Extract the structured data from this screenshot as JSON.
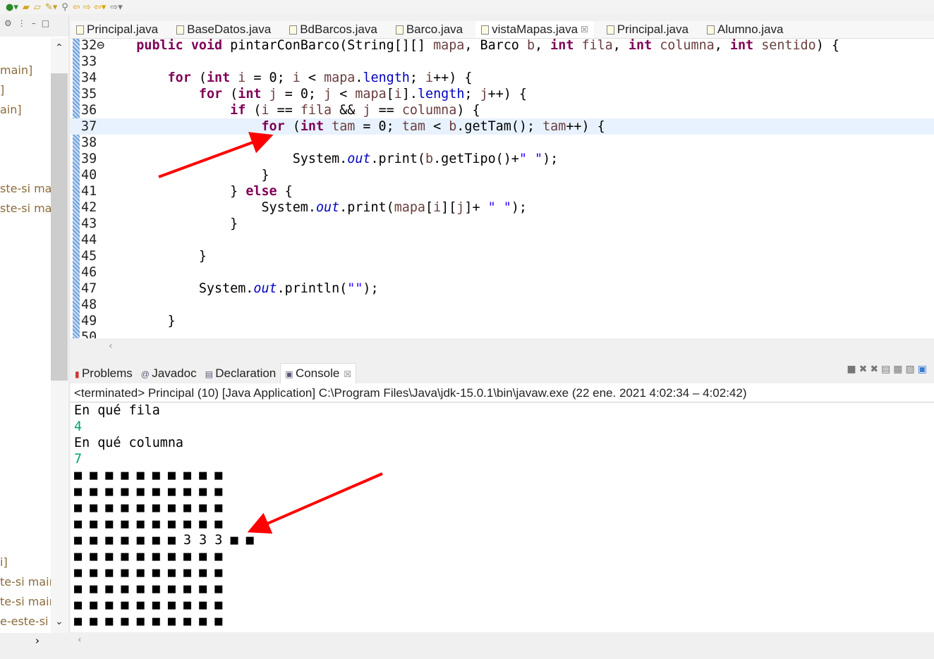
{
  "toolbar": {
    "icons": [
      "run-icon",
      "open-icon",
      "folder-icon",
      "pencil-icon",
      "pin-icon",
      "back-icon",
      "forward-icon"
    ]
  },
  "left_panel": {
    "items": [
      "main]",
      "]",
      "ain]",
      "ste-si ma",
      "ste-si ma",
      "i]",
      "te-si mair",
      "te-si mair",
      "e-este-si i"
    ]
  },
  "tabs": [
    "Principal.java",
    "BaseDatos.java",
    "BdBarcos.java",
    "Barco.java",
    "vistaMapas.java",
    "Principal.java",
    "Alumno.java"
  ],
  "active_tab": 4,
  "tab_close": "☒",
  "editor": {
    "current_line": 5,
    "lines": [
      {
        "n": "32⊖",
        "t": [
          [
            "    ",
            ""
          ],
          [
            "public",
            "k"
          ],
          [
            " ",
            ""
          ],
          [
            "void",
            "k"
          ],
          [
            " pintarConBarco(String[][] ",
            ""
          ],
          [
            "mapa",
            "v"
          ],
          [
            ", Barco ",
            ""
          ],
          [
            "b",
            "v"
          ],
          [
            ", ",
            ""
          ],
          [
            "int",
            "k"
          ],
          [
            " ",
            ""
          ],
          [
            "fila",
            "v"
          ],
          [
            ", ",
            ""
          ],
          [
            "int",
            "k"
          ],
          [
            " ",
            ""
          ],
          [
            "columna",
            "v"
          ],
          [
            ", ",
            ""
          ],
          [
            "int",
            "k"
          ],
          [
            " ",
            ""
          ],
          [
            "sentido",
            "v"
          ],
          [
            ") {",
            ""
          ]
        ]
      },
      {
        "n": "33",
        "t": []
      },
      {
        "n": "34",
        "t": [
          [
            "        ",
            ""
          ],
          [
            "for",
            "k"
          ],
          [
            " (",
            ""
          ],
          [
            "int",
            "k"
          ],
          [
            " ",
            ""
          ],
          [
            "i",
            "v"
          ],
          [
            " = 0; ",
            ""
          ],
          [
            "i",
            "v"
          ],
          [
            " < ",
            ""
          ],
          [
            "mapa",
            "v"
          ],
          [
            ".",
            ""
          ],
          [
            "length",
            "f"
          ],
          [
            "; ",
            ""
          ],
          [
            "i",
            "v"
          ],
          [
            "++) {",
            ""
          ]
        ]
      },
      {
        "n": "35",
        "t": [
          [
            "            ",
            ""
          ],
          [
            "for",
            "k"
          ],
          [
            " (",
            ""
          ],
          [
            "int",
            "k"
          ],
          [
            " ",
            ""
          ],
          [
            "j",
            "v"
          ],
          [
            " = 0; ",
            ""
          ],
          [
            "j",
            "v"
          ],
          [
            " < ",
            ""
          ],
          [
            "mapa",
            "v"
          ],
          [
            "[",
            ""
          ],
          [
            "i",
            "v"
          ],
          [
            "].",
            ""
          ],
          [
            "length",
            "f"
          ],
          [
            "; ",
            ""
          ],
          [
            "j",
            "v"
          ],
          [
            "++) {",
            ""
          ]
        ]
      },
      {
        "n": "36",
        "t": [
          [
            "                ",
            ""
          ],
          [
            "if",
            "k"
          ],
          [
            " (",
            ""
          ],
          [
            "i",
            "v"
          ],
          [
            " == ",
            ""
          ],
          [
            "fila",
            "v"
          ],
          [
            " && ",
            ""
          ],
          [
            "j",
            "v"
          ],
          [
            " == ",
            ""
          ],
          [
            "columna",
            "v"
          ],
          [
            ") {",
            ""
          ]
        ]
      },
      {
        "n": "37",
        "t": [
          [
            "                    ",
            ""
          ],
          [
            "for",
            "k"
          ],
          [
            " (",
            ""
          ],
          [
            "int",
            "k"
          ],
          [
            " ",
            ""
          ],
          [
            "tam",
            "v"
          ],
          [
            " = 0; ",
            ""
          ],
          [
            "tam",
            "v"
          ],
          [
            " < ",
            ""
          ],
          [
            "b",
            "v"
          ],
          [
            ".getTam(); ",
            ""
          ],
          [
            "tam",
            "v"
          ],
          [
            "++) {",
            ""
          ]
        ]
      },
      {
        "n": "38",
        "t": []
      },
      {
        "n": "39",
        "t": [
          [
            "                        System.",
            ""
          ],
          [
            "out",
            "fi"
          ],
          [
            ".print(",
            ""
          ],
          [
            "b",
            "v"
          ],
          [
            ".getTipo()+",
            ""
          ],
          [
            "\" \"",
            "s"
          ],
          [
            ");",
            ""
          ]
        ]
      },
      {
        "n": "40",
        "t": [
          [
            "                    }",
            ""
          ]
        ]
      },
      {
        "n": "41",
        "t": [
          [
            "                } ",
            ""
          ],
          [
            "else",
            "k"
          ],
          [
            " {",
            ""
          ]
        ]
      },
      {
        "n": "42",
        "t": [
          [
            "                    System.",
            ""
          ],
          [
            "out",
            "fi"
          ],
          [
            ".print(",
            ""
          ],
          [
            "mapa",
            "v"
          ],
          [
            "[",
            ""
          ],
          [
            "i",
            "v"
          ],
          [
            "][",
            ""
          ],
          [
            "j",
            "v"
          ],
          [
            "]+ ",
            ""
          ],
          [
            "\" \"",
            "s"
          ],
          [
            ");",
            ""
          ]
        ]
      },
      {
        "n": "43",
        "t": [
          [
            "                }",
            ""
          ]
        ]
      },
      {
        "n": "44",
        "t": []
      },
      {
        "n": "45",
        "t": [
          [
            "            }",
            ""
          ]
        ]
      },
      {
        "n": "46",
        "t": []
      },
      {
        "n": "47",
        "t": [
          [
            "            System.",
            ""
          ],
          [
            "out",
            "fi"
          ],
          [
            ".println(",
            ""
          ],
          [
            "\"\"",
            "s"
          ],
          [
            ");",
            ""
          ]
        ]
      },
      {
        "n": "48",
        "t": []
      },
      {
        "n": "49",
        "t": [
          [
            "        }",
            ""
          ]
        ]
      },
      {
        "n": "50",
        "t": []
      }
    ]
  },
  "panel_tabs": [
    "Problems",
    "Javadoc",
    "Declaration",
    "Console"
  ],
  "console": {
    "status": "<terminated> Principal (10) [Java Application] C:\\Program Files\\Java\\jdk-15.0.1\\bin\\javaw.exe  (22 ene. 2021 4:02:34 – 4:02:42)",
    "lines": [
      {
        "text": "En qué fila",
        "input": false
      },
      {
        "text": "4",
        "input": true
      },
      {
        "text": "En qué columna",
        "input": false
      },
      {
        "text": "7",
        "input": true
      },
      {
        "text": "■ ■ ■ ■ ■ ■ ■ ■ ■ ■",
        "input": false
      },
      {
        "text": "■ ■ ■ ■ ■ ■ ■ ■ ■ ■",
        "input": false
      },
      {
        "text": "■ ■ ■ ■ ■ ■ ■ ■ ■ ■",
        "input": false
      },
      {
        "text": "■ ■ ■ ■ ■ ■ ■ ■ ■ ■",
        "input": false
      },
      {
        "text": "■ ■ ■ ■ ■ ■ ■ 3 3 3 ■ ■",
        "input": false
      },
      {
        "text": "■ ■ ■ ■ ■ ■ ■ ■ ■ ■",
        "input": false
      },
      {
        "text": "■ ■ ■ ■ ■ ■ ■ ■ ■ ■",
        "input": false
      },
      {
        "text": "■ ■ ■ ■ ■ ■ ■ ■ ■ ■",
        "input": false
      },
      {
        "text": "■ ■ ■ ■ ■ ■ ■ ■ ■ ■",
        "input": false
      },
      {
        "text": "■ ■ ■ ■ ■ ■ ■ ■ ■ ■",
        "input": false
      }
    ]
  },
  "colors": {
    "keyword": "#7f0055",
    "field": "#0000c0",
    "string": "#2a00ff",
    "input": "#00a070",
    "annotation_arrow": "#ff0000"
  }
}
